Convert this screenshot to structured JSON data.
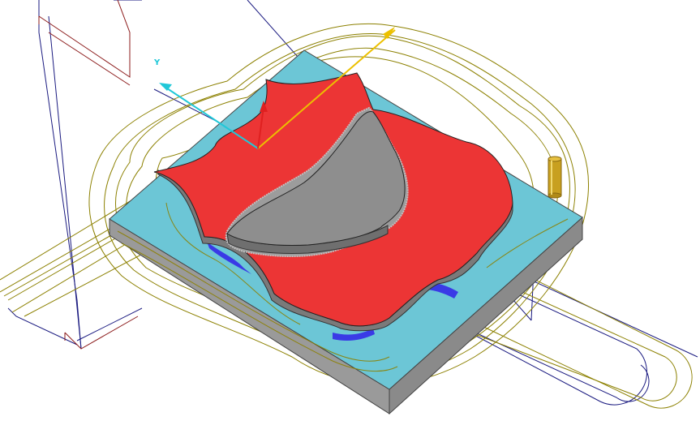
{
  "scene": {
    "colors": {
      "background": "#ffffff",
      "stock_top": "#6cc6d6",
      "stock_side": "#999999",
      "part_red": "#ec3535",
      "part_red_wall": "#8a8a8a",
      "island_gray": "#8e8e8e",
      "island_wall": "#6f6f6f",
      "gouge_blue": "#3a3ae6",
      "toolpath": "#8c8000",
      "wireframe_dark_red": "#8b1a1a",
      "wireframe_navy": "#1a1a80",
      "tool": "#c8a020"
    },
    "axes": {
      "y_label": "Y",
      "x_color": "#ecc000",
      "y_color": "#20c8d8",
      "z_color": "#e02020"
    },
    "tool": {
      "name": "tool-holder-icon"
    }
  }
}
